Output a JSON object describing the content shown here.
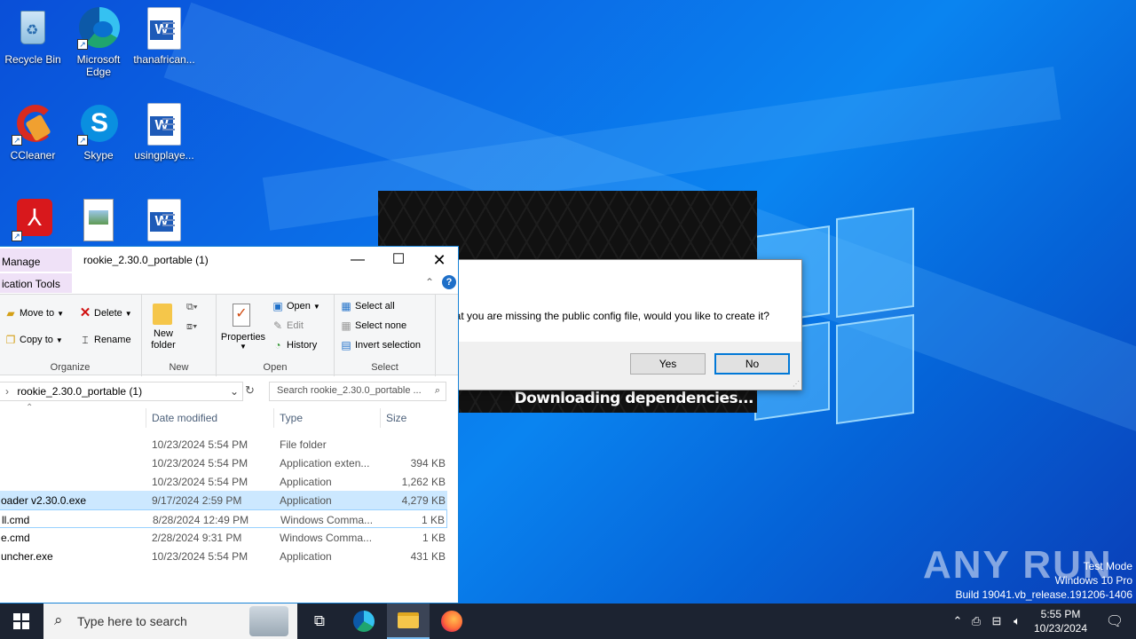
{
  "desktop": {
    "icons": [
      {
        "label": "Recycle Bin"
      },
      {
        "label": "Microsoft Edge"
      },
      {
        "label": "thanafrican..."
      },
      {
        "label": "CCleaner"
      },
      {
        "label": "Skype"
      },
      {
        "label": "usingplaye..."
      }
    ]
  },
  "splash": {
    "status": "Downloading dependencies..."
  },
  "dialog": {
    "message": "hat you are missing the public config file, would you like to create it?",
    "yes_label": "Yes",
    "no_label": "No"
  },
  "explorer": {
    "title": "rookie_2.30.0_portable (1)",
    "context_tab": "Manage",
    "context_sub": "ication Tools",
    "ribbon": {
      "organize": {
        "label": "Organize",
        "move_to": "Move to",
        "copy_to": "Copy to",
        "delete": "Delete",
        "rename": "Rename"
      },
      "new": {
        "label": "New",
        "new_folder_line1": "New",
        "new_folder_line2": "folder"
      },
      "open": {
        "label": "Open",
        "properties": "Properties",
        "open": "Open",
        "edit": "Edit",
        "history": "History"
      },
      "select": {
        "label": "Select",
        "select_all": "Select all",
        "select_none": "Select none",
        "invert": "Invert selection"
      }
    },
    "address": "rookie_2.30.0_portable (1)",
    "search_placeholder": "Search rookie_2.30.0_portable ...",
    "columns": {
      "date": "Date modified",
      "type": "Type",
      "size": "Size"
    },
    "rows": [
      {
        "name": "",
        "date": "10/23/2024 5:54 PM",
        "type": "File folder",
        "size": ""
      },
      {
        "name": "",
        "date": "10/23/2024 5:54 PM",
        "type": "Application exten...",
        "size": "394 KB"
      },
      {
        "name": "",
        "date": "10/23/2024 5:54 PM",
        "type": "Application",
        "size": "1,262 KB"
      },
      {
        "name": "oader v2.30.0.exe",
        "date": "9/17/2024 2:59 PM",
        "type": "Application",
        "size": "4,279 KB"
      },
      {
        "name": "ll.cmd",
        "date": "8/28/2024 12:49 PM",
        "type": "Windows Comma...",
        "size": "1 KB"
      },
      {
        "name": "e.cmd",
        "date": "2/28/2024 9:31 PM",
        "type": "Windows Comma...",
        "size": "1 KB"
      },
      {
        "name": "uncher.exe",
        "date": "10/23/2024 5:54 PM",
        "type": "Application",
        "size": "431 KB"
      }
    ]
  },
  "watermark": {
    "brand": "ANY RUN",
    "line1": "Test Mode",
    "line2": "Windows 10 Pro",
    "line3": "Build 19041.vb_release.191206-1406"
  },
  "taskbar": {
    "search_placeholder": "Type here to search",
    "time": "5:55 PM",
    "date": "10/23/2024"
  }
}
